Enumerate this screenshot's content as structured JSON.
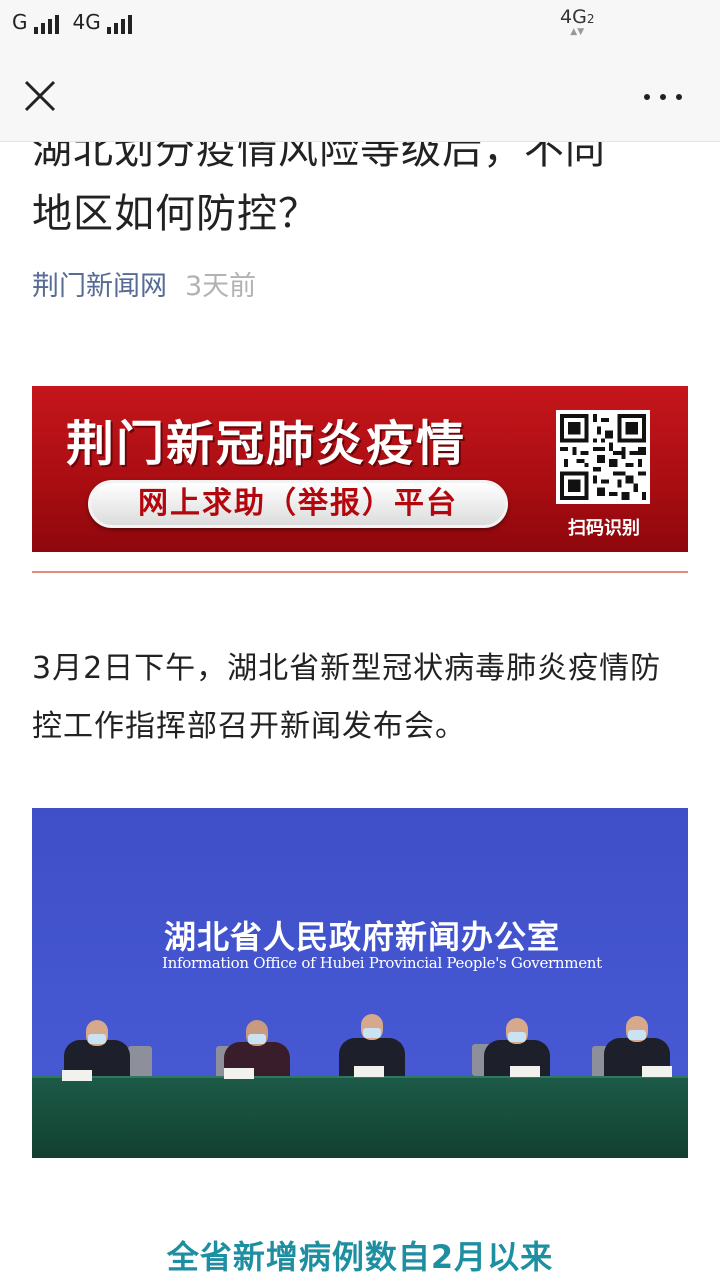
{
  "status_bar": {
    "carrier1": "G",
    "carrier2": "4G",
    "right_network": "4G",
    "right_network_sub": "2"
  },
  "nav": {
    "close_icon": "close-icon",
    "more_icon": "more-dots-icon"
  },
  "article": {
    "title_line1": "湖北划分疫情风险等级后，不同",
    "title_line2": "地区如何防控？",
    "source": "荆门新闻网",
    "time": "3天前",
    "banner": {
      "title": "荆门新冠肺炎疫情",
      "pill_text": "网上求助（举报）平台",
      "qr_label": "扫码识别"
    },
    "paragraph": "3月2日下午，湖北省新型冠状病毒肺炎疫情防控工作指挥部召开新闻发布会。",
    "photo": {
      "backdrop_cn": "湖北省人民政府新闻办公室",
      "backdrop_en": "Information Office of Hubei Provincial People's Government"
    },
    "subheading": "全省新增病例数自2月以来"
  },
  "colors": {
    "source_link": "#576b95",
    "banner_red": "#b3070d",
    "subheading_teal": "#1d8fa0",
    "backdrop_blue": "#4456d0"
  }
}
